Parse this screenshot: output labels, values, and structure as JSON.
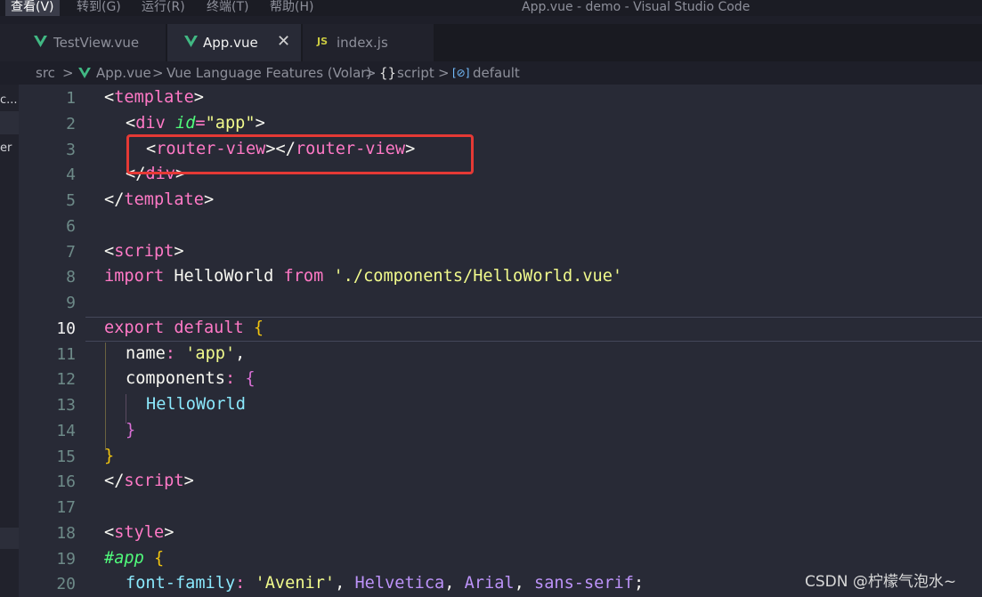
{
  "menu": {
    "items": [
      {
        "label": "查看(V)",
        "active": true
      },
      {
        "label": "转到(G)"
      },
      {
        "label": "运行(R)"
      },
      {
        "label": "终端(T)"
      },
      {
        "label": "帮助(H)"
      }
    ]
  },
  "window_title": "App.vue - demo - Visual Studio Code",
  "tabs": [
    {
      "label": "TestView.vue",
      "icon": "vue-icon"
    },
    {
      "label": "App.vue",
      "icon": "vue-icon",
      "active": true,
      "close": "✕"
    },
    {
      "label": "index.js",
      "icon": "js-icon",
      "icon_text": "JS"
    }
  ],
  "breadcrumb": {
    "src": "src",
    "file": "App.vue",
    "ext": "Vue Language Features (Volar)",
    "script_icon": "{}",
    "script": "script",
    "default_icon": "[⊘]",
    "default": "default",
    "sep": ">"
  },
  "side": {
    "label1": "c...",
    "label2": "er"
  },
  "editor": {
    "current_line": 10,
    "line_numbers": [
      "1",
      "2",
      "3",
      "4",
      "5",
      "6",
      "7",
      "8",
      "9",
      "10",
      "11",
      "12",
      "13",
      "14",
      "15",
      "16",
      "17",
      "18",
      "19",
      "20"
    ],
    "lines": {
      "l1": {
        "open": "<",
        "tag": "template",
        "close": ">"
      },
      "l2": {
        "open": "<",
        "tag": "div",
        "attr": "id",
        "eq": "=",
        "val": "\"app\"",
        "close": ">"
      },
      "l3": {
        "open": "<",
        "tag": "router-view",
        "mid": "></",
        "tag2": "router-view",
        "close": ">"
      },
      "l4": {
        "open": "</",
        "tag": "div",
        "close": ">"
      },
      "l5": {
        "open": "</",
        "tag": "template",
        "close": ">"
      },
      "l7": {
        "open": "<",
        "tag": "script",
        "close": ">"
      },
      "l8": {
        "kw": "import",
        "id": " HelloWorld ",
        "kw2": "from",
        "str": " './components/HelloWorld.vue'"
      },
      "l10": {
        "kw": "export",
        "kw2": " default",
        "brace": " {"
      },
      "l11": {
        "id": "name",
        "colon": ":",
        "str": " 'app'",
        "comma": ","
      },
      "l12": {
        "id": "components",
        "colon": ":",
        "brace": " {"
      },
      "l13": {
        "comp": "HelloWorld"
      },
      "l14": {
        "brace": "}"
      },
      "l15": {
        "brace": "}"
      },
      "l16": {
        "open": "</",
        "tag": "script",
        "close": ">"
      },
      "l18": {
        "open": "<",
        "tag": "style",
        "close": ">"
      },
      "l19": {
        "sel": "#app",
        "brace": " {"
      },
      "l20": {
        "prop": "font-family",
        "colon": ":",
        "str": " 'Avenir'",
        "c1": ", ",
        "v1": "Helvetica",
        "c2": ", ",
        "v2": "Arial",
        "c3": ", ",
        "v3": "sans-serif",
        "semi": ";"
      }
    }
  },
  "watermark": "CSDN @柠檬气泡水~"
}
